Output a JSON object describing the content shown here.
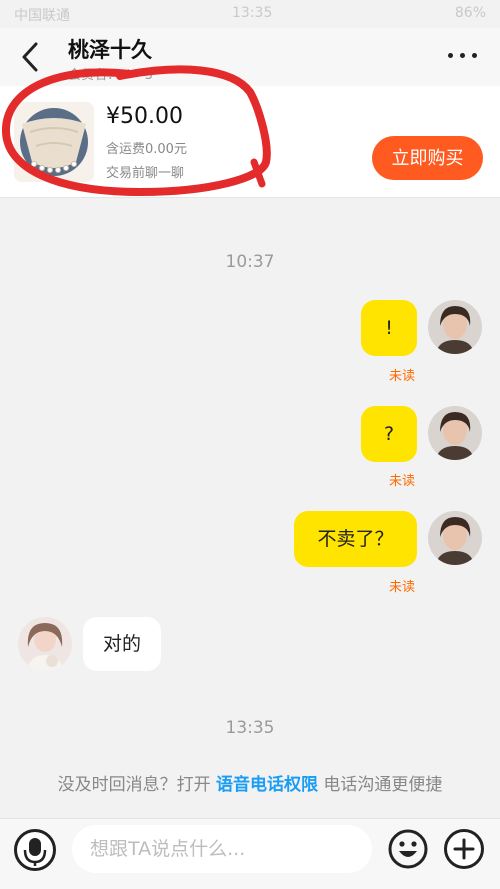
{
  "status_bar": {
    "carrier": "中国联通",
    "time": "13:35",
    "battery": "86%"
  },
  "header": {
    "title": "桃泽十久",
    "subtitle": "会员名：t***3"
  },
  "product": {
    "price": "¥50.00",
    "shipping": "含运费0.00元",
    "note": "交易前聊一聊",
    "buy_label": "立即购买"
  },
  "messages": {
    "time_1": "10:37",
    "msg_1": "!",
    "msg_2": "?",
    "msg_3": "不卖了？",
    "unread_label": "未读",
    "reply_1": "对的",
    "time_2": "13:35"
  },
  "tip": {
    "prefix": "没及时回消息？打开 ",
    "link": "语音电话权限",
    "suffix": " 电话沟通更便捷"
  },
  "input": {
    "placeholder": "想跟TA说点什么..."
  },
  "icons": {
    "back": "chevron-left-icon",
    "more": "more-dots-icon",
    "mic": "microphone-icon",
    "emoji": "smiley-icon",
    "plus": "plus-icon"
  },
  "colors": {
    "accent": "#ff5a1f",
    "bubble_out": "#ffe400",
    "unread": "#ff6a00",
    "link": "#1a9df5"
  }
}
